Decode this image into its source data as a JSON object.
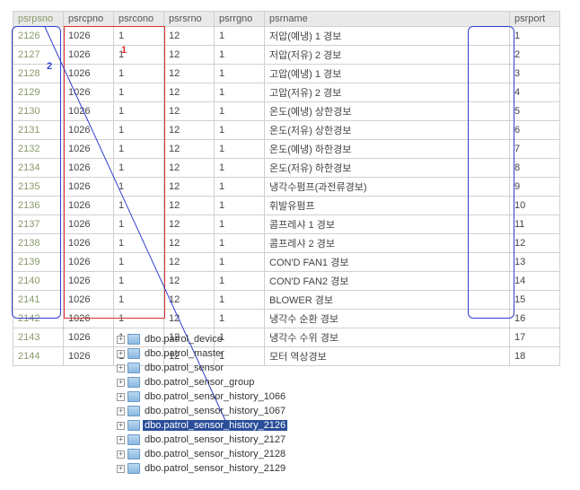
{
  "columns": {
    "psrpsno": "psrpsno",
    "psrcpno": "psrcpno",
    "psrcono": "psrcono",
    "psrsrno": "psrsrno",
    "psrrgno": "psrrgno",
    "psrname": "psrname",
    "psrport": "psrport"
  },
  "rows": [
    {
      "psno": "2126",
      "cpno": "1026",
      "cono": "1",
      "srno": "12",
      "rgno": "1",
      "name": "저압(예냉) 1 경보",
      "port": "1"
    },
    {
      "psno": "2127",
      "cpno": "1026",
      "cono": "1",
      "srno": "12",
      "rgno": "1",
      "name": "저압(저유) 2 경보",
      "port": "2"
    },
    {
      "psno": "2128",
      "cpno": "1026",
      "cono": "1",
      "srno": "12",
      "rgno": "1",
      "name": "고압(예냉) 1 경보",
      "port": "3"
    },
    {
      "psno": "2129",
      "cpno": "1026",
      "cono": "1",
      "srno": "12",
      "rgno": "1",
      "name": "고압(저유) 2 경보",
      "port": "4"
    },
    {
      "psno": "2130",
      "cpno": "1026",
      "cono": "1",
      "srno": "12",
      "rgno": "1",
      "name": "온도(예냉) 상한경보",
      "port": "5"
    },
    {
      "psno": "2131",
      "cpno": "1026",
      "cono": "1",
      "srno": "12",
      "rgno": "1",
      "name": "온도(저유) 상한경보",
      "port": "6"
    },
    {
      "psno": "2132",
      "cpno": "1026",
      "cono": "1",
      "srno": "12",
      "rgno": "1",
      "name": "온도(예냉) 하한경보",
      "port": "7"
    },
    {
      "psno": "2134",
      "cpno": "1026",
      "cono": "1",
      "srno": "12",
      "rgno": "1",
      "name": "온도(저유) 하한경보",
      "port": "8"
    },
    {
      "psno": "2135",
      "cpno": "1026",
      "cono": "1",
      "srno": "12",
      "rgno": "1",
      "name": "냉각수펌프(과전류경보)",
      "port": "9"
    },
    {
      "psno": "2136",
      "cpno": "1026",
      "cono": "1",
      "srno": "12",
      "rgno": "1",
      "name": "휘발유펌프",
      "port": "10"
    },
    {
      "psno": "2137",
      "cpno": "1026",
      "cono": "1",
      "srno": "12",
      "rgno": "1",
      "name": "콤프레샤 1 경보",
      "port": "11"
    },
    {
      "psno": "2138",
      "cpno": "1026",
      "cono": "1",
      "srno": "12",
      "rgno": "1",
      "name": "콤프레샤 2 경보",
      "port": "12"
    },
    {
      "psno": "2139",
      "cpno": "1026",
      "cono": "1",
      "srno": "12",
      "rgno": "1",
      "name": "CON'D FAN1 경보",
      "port": "13"
    },
    {
      "psno": "2140",
      "cpno": "1026",
      "cono": "1",
      "srno": "12",
      "rgno": "1",
      "name": "CON'D FAN2 경보",
      "port": "14"
    },
    {
      "psno": "2141",
      "cpno": "1026",
      "cono": "1",
      "srno": "12",
      "rgno": "1",
      "name": "BLOWER 경보",
      "port": "15"
    },
    {
      "psno": "2142",
      "cpno": "1026",
      "cono": "1",
      "srno": "12",
      "rgno": "1",
      "name": "냉각수 순환 경보",
      "port": "16"
    },
    {
      "psno": "2143",
      "cpno": "1026",
      "cono": "1",
      "srno": "12",
      "rgno": "1",
      "name": "냉각수 수위 경보",
      "port": "17"
    },
    {
      "psno": "2144",
      "cpno": "1026",
      "cono": "1",
      "srno": "12",
      "rgno": "1",
      "name": "모터 역상경보",
      "port": "18"
    }
  ],
  "tree": {
    "items": [
      {
        "label": "dbo.patrol_device"
      },
      {
        "label": "dbo.patrol_master"
      },
      {
        "label": "dbo.patrol_sensor"
      },
      {
        "label": "dbo.patrol_sensor_group"
      },
      {
        "label": "dbo.patrol_sensor_history_1066"
      },
      {
        "label": "dbo.patrol_sensor_history_1067"
      },
      {
        "label": "dbo.patrol_sensor_history_2126",
        "selected": true
      },
      {
        "label": "dbo.patrol_sensor_history_2127"
      },
      {
        "label": "dbo.patrol_sensor_history_2128"
      },
      {
        "label": "dbo.patrol_sensor_history_2129"
      }
    ]
  },
  "annotations": {
    "label1": "1",
    "label2": "2"
  }
}
